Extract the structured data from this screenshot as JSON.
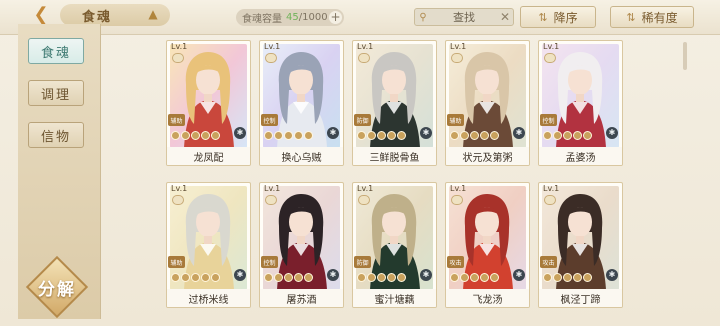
{
  "header": {
    "title": "食魂",
    "capacity_label": "食魂容量",
    "capacity_current": "45",
    "capacity_total": "/1000",
    "search_label": "查找",
    "sort_order_label": "降序",
    "sort_field_label": "稀有度"
  },
  "sidebar": {
    "items": [
      {
        "label": "食魂",
        "active": true
      },
      {
        "label": "调理",
        "active": false
      },
      {
        "label": "信物",
        "active": false
      }
    ],
    "decompose_label": "分解"
  },
  "cards": [
    {
      "level": "Lv.1",
      "name": "龙凤配",
      "tag": "辅助",
      "bg": [
        "#f9e6b8",
        "#f2c7d7",
        "#d6e6f7"
      ],
      "hair": "#e9c27a",
      "robe": "#c9473c"
    },
    {
      "level": "Lv.1",
      "name": "换心乌贼",
      "tag": "控制",
      "bg": [
        "#e8eef8",
        "#d9d2f2",
        "#c8e0f0"
      ],
      "hair": "#9aa3b6",
      "robe": "#e7eaf0"
    },
    {
      "level": "Lv.1",
      "name": "三鲜脱骨鱼",
      "tag": "防御",
      "bg": [
        "#f3ead8",
        "#e6e2d2",
        "#d4e0d8"
      ],
      "hair": "#c9c7c3",
      "robe": "#2c3530"
    },
    {
      "level": "Lv.1",
      "name": "状元及第粥",
      "tag": "辅助",
      "bg": [
        "#f5edd9",
        "#ecdcc3",
        "#dfe3d3"
      ],
      "hair": "#d9c6a8",
      "robe": "#6b4a37"
    },
    {
      "level": "Lv.1",
      "name": "孟婆汤",
      "tag": "控制",
      "bg": [
        "#f4e4ef",
        "#e5dbf1",
        "#d7e6f3"
      ],
      "hair": "#f1eef0",
      "robe": "#b23240"
    },
    {
      "level": "Lv.1",
      "name": "过桥米线",
      "tag": "辅助",
      "bg": [
        "#f7efd2",
        "#efe6c0",
        "#dbe8d5"
      ],
      "hair": "#d9d8cf",
      "robe": "#e8d39a"
    },
    {
      "level": "Lv.1",
      "name": "屠苏酒",
      "tag": "控制",
      "bg": [
        "#f2e6dc",
        "#ead7d6",
        "#dcdcec"
      ],
      "hair": "#2c2326",
      "robe": "#7a1f2c"
    },
    {
      "level": "Lv.1",
      "name": "蜜汁塘藕",
      "tag": "防御",
      "bg": [
        "#efe9d6",
        "#e6dcc2",
        "#d7e2cf"
      ],
      "hair": "#bfb08a",
      "robe": "#233a2d"
    },
    {
      "level": "Lv.1",
      "name": "飞龙汤",
      "tag": "攻击",
      "bg": [
        "#f6e1d4",
        "#f0cfc3",
        "#e6d9e6"
      ],
      "hair": "#a8322a",
      "robe": "#d2412f"
    },
    {
      "level": "Lv.1",
      "name": "枫泾丁蹄",
      "tag": "攻击",
      "bg": [
        "#f3e8da",
        "#eadccb",
        "#dde2d7"
      ],
      "hair": "#3b2c26",
      "robe": "#5c3d2c"
    }
  ],
  "icons": {
    "back": "back-arrow-icon",
    "crown": "crown-icon",
    "plus": "plus-icon",
    "search": "search-icon",
    "close": "close-icon",
    "sort": "sort-icon",
    "filter": "filter-icon",
    "gear": "gear-icon"
  }
}
